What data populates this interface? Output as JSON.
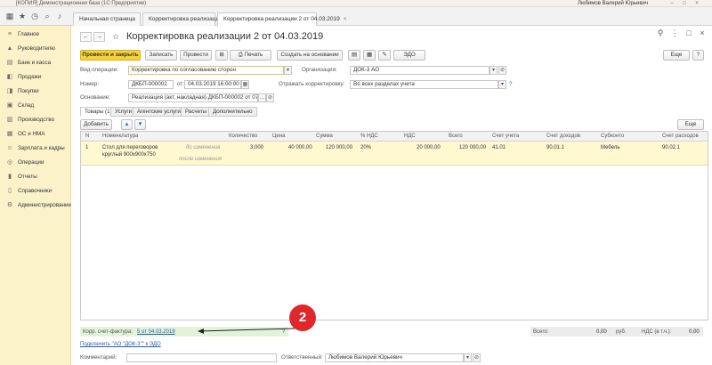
{
  "window": {
    "title": "[КОПИЯ] Демонстрационная база (1С:Предприятие)",
    "user": "Любимов Валерий Юрьевич"
  },
  "tabs": [
    {
      "label": "Начальная страница"
    },
    {
      "label": "Корректировка реализации"
    },
    {
      "label": "Корректировка реализации 2 от 04.03.2019"
    }
  ],
  "sidebar": {
    "items": [
      {
        "label": "Главное",
        "icon": "menu-icon"
      },
      {
        "label": "Руководителю",
        "icon": "chart-icon"
      },
      {
        "label": "Банк и касса",
        "icon": "bank-icon"
      },
      {
        "label": "Продажи",
        "icon": "cart-icon"
      },
      {
        "label": "Покупки",
        "icon": "basket-icon"
      },
      {
        "label": "Склад",
        "icon": "warehouse-icon"
      },
      {
        "label": "Производство",
        "icon": "factory-icon"
      },
      {
        "label": "ОС и НМА",
        "icon": "assets-icon"
      },
      {
        "label": "Зарплата и кадры",
        "icon": "people-icon"
      },
      {
        "label": "Операции",
        "icon": "operations-icon"
      },
      {
        "label": "Отчеты",
        "icon": "reports-icon"
      },
      {
        "label": "Справочники",
        "icon": "book-icon"
      },
      {
        "label": "Администрирование",
        "icon": "gear-icon"
      }
    ]
  },
  "doc": {
    "title": "Корректировка реализации 2 от 04.03.2019"
  },
  "toolbar": {
    "post_close": "Провести и закрыть",
    "save": "Записать",
    "post": "Провести",
    "print": "Печать",
    "create_based": "Создать на основании",
    "edo": "ЭДО",
    "more": "Еще"
  },
  "form": {
    "operation_label": "Вид операции:",
    "operation_value": "Корректировка по согласованию сторон",
    "org_label": "Организация:",
    "org_value": "ДОК-3 АО",
    "number_label": "Номер:",
    "number_value": "ДКБП-000002",
    "date_label": "от:",
    "date_value": "04.03.2019 16:00:00",
    "reflect_label": "Отражать корректировку:",
    "reflect_value": "Во всех разделах учета",
    "basis_label": "Основание:",
    "basis_value": "Реализация (акт, накладная) ДКБП-000002 от 07.02.2019"
  },
  "form_tabs": [
    {
      "label": "Товары (1)"
    },
    {
      "label": "Услуги"
    },
    {
      "label": "Агентские услуги"
    },
    {
      "label": "Расчеты"
    },
    {
      "label": "Дополнительно"
    }
  ],
  "table_toolbar": {
    "add": "Добавить",
    "more": "Еще"
  },
  "table": {
    "columns": [
      "N",
      "Номенклатура",
      "Количество",
      "Цена",
      "Сумма",
      "% НДС",
      "НДС",
      "Всего",
      "Счет учета",
      "Счет доходов",
      "Субконто",
      "Счет расходов"
    ],
    "rows": [
      {
        "n": "1",
        "name": "Стол для переговоров круглый 900х900х750",
        "before": "до изменения",
        "after": "после изменения",
        "qty": "3,000",
        "price": "40 000,00",
        "sum": "120 000,00",
        "vat_rate": "20%",
        "vat": "20 000,00",
        "total": "120 000,00",
        "acc": "41.01",
        "income_acc": "90.01.1",
        "subconto": "Мебель",
        "expense_acc": "90.02.1"
      }
    ]
  },
  "footer": {
    "invoice_label": "Корр. счет-фактура:",
    "invoice_link": "5 от 04.03.2019",
    "invoice_q": "?",
    "connect_link": "Подключить \"АО \"ДОК-3\"\" к ЭДО",
    "total_label": "Всего:",
    "total_value": "0,00",
    "currency": "руб.",
    "vat_label": "НДС (в т.ч.):",
    "vat_value": "0,00",
    "comment_label": "Комментарий:",
    "comment_value": "",
    "resp_label": "Ответственный:",
    "resp_value": "Любимов Валерий Юрьевич"
  },
  "annotation": {
    "marker": "2"
  },
  "colors": {
    "accent_yellow": "#f6d435",
    "sidebar_bg": "#fbf2c9",
    "row_highlight": "#fff8d0",
    "marker_red": "#e0282c",
    "invoice_bg": "#e3f3da"
  }
}
